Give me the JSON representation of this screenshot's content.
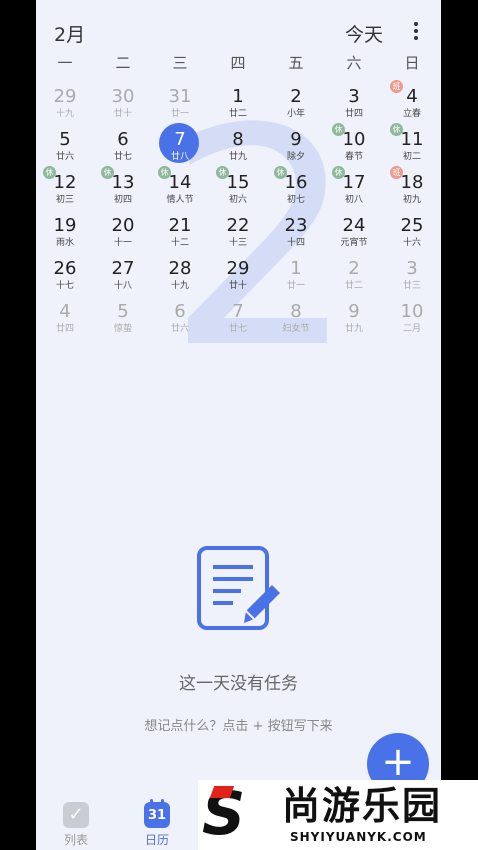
{
  "header": {
    "month": "2月",
    "today_label": "今天"
  },
  "weekdays": [
    "一",
    "二",
    "三",
    "四",
    "五",
    "六",
    "日"
  ],
  "watermark_digit": "2",
  "calendar_rows": [
    [
      {
        "day": "29",
        "lunar": "十九",
        "dim": true
      },
      {
        "day": "30",
        "lunar": "廿十",
        "dim": true
      },
      {
        "day": "31",
        "lunar": "廿一",
        "dim": true
      },
      {
        "day": "1",
        "lunar": "廿二"
      },
      {
        "day": "2",
        "lunar": "小年"
      },
      {
        "day": "3",
        "lunar": "廿四"
      },
      {
        "day": "4",
        "lunar": "立春",
        "badge": "班",
        "badge_type": "work"
      }
    ],
    [
      {
        "day": "5",
        "lunar": "廿六"
      },
      {
        "day": "6",
        "lunar": "廿七"
      },
      {
        "day": "7",
        "lunar": "廿八",
        "selected": true
      },
      {
        "day": "8",
        "lunar": "廿九"
      },
      {
        "day": "9",
        "lunar": "除夕"
      },
      {
        "day": "10",
        "lunar": "春节",
        "badge": "休",
        "badge_type": "rest"
      },
      {
        "day": "11",
        "lunar": "初二",
        "badge": "休",
        "badge_type": "rest"
      }
    ],
    [
      {
        "day": "12",
        "lunar": "初三",
        "badge": "休",
        "badge_type": "rest"
      },
      {
        "day": "13",
        "lunar": "初四",
        "badge": "休",
        "badge_type": "rest"
      },
      {
        "day": "14",
        "lunar": "情人节",
        "badge": "休",
        "badge_type": "rest"
      },
      {
        "day": "15",
        "lunar": "初六",
        "badge": "休",
        "badge_type": "rest"
      },
      {
        "day": "16",
        "lunar": "初七",
        "badge": "休",
        "badge_type": "rest"
      },
      {
        "day": "17",
        "lunar": "初八",
        "badge": "休",
        "badge_type": "rest"
      },
      {
        "day": "18",
        "lunar": "初九",
        "badge": "班",
        "badge_type": "work"
      }
    ],
    [
      {
        "day": "19",
        "lunar": "雨水"
      },
      {
        "day": "20",
        "lunar": "十一"
      },
      {
        "day": "21",
        "lunar": "十二"
      },
      {
        "day": "22",
        "lunar": "十三"
      },
      {
        "day": "23",
        "lunar": "十四"
      },
      {
        "day": "24",
        "lunar": "元宵节"
      },
      {
        "day": "25",
        "lunar": "十六"
      }
    ],
    [
      {
        "day": "26",
        "lunar": "十七"
      },
      {
        "day": "27",
        "lunar": "十八"
      },
      {
        "day": "28",
        "lunar": "十九"
      },
      {
        "day": "29",
        "lunar": "廿十"
      },
      {
        "day": "1",
        "lunar": "廿一",
        "dim": true
      },
      {
        "day": "2",
        "lunar": "廿二",
        "dim": true
      },
      {
        "day": "3",
        "lunar": "廿三",
        "dim": true
      }
    ],
    [
      {
        "day": "4",
        "lunar": "廿四",
        "dim": true
      },
      {
        "day": "5",
        "lunar": "惊蛰",
        "dim": true
      },
      {
        "day": "6",
        "lunar": "廿六",
        "dim": true
      },
      {
        "day": "7",
        "lunar": "廿七",
        "dim": true
      },
      {
        "day": "8",
        "lunar": "妇女节",
        "dim": true
      },
      {
        "day": "9",
        "lunar": "廿九",
        "dim": true
      },
      {
        "day": "10",
        "lunar": "二月",
        "dim": true
      }
    ]
  ],
  "empty_state": {
    "icon": "note-edit-icon",
    "title": "这一天没有任务",
    "hint": "想记点什么？点击 + 按钮写下来"
  },
  "fab_label": "+",
  "tabs": [
    {
      "label": "列表",
      "icon": "check-list-icon",
      "active": false
    },
    {
      "label": "日历",
      "icon": "calendar-icon",
      "icon_text": "31",
      "active": true
    }
  ],
  "watermark_logo": {
    "title": "尚游乐园",
    "subtitle": "SHYIYUANYK.COM"
  },
  "colors": {
    "accent": "#4a72e8",
    "background": "#eff1fb",
    "rest_badge": "#8fb89b",
    "work_badge": "#ee9a8e"
  }
}
